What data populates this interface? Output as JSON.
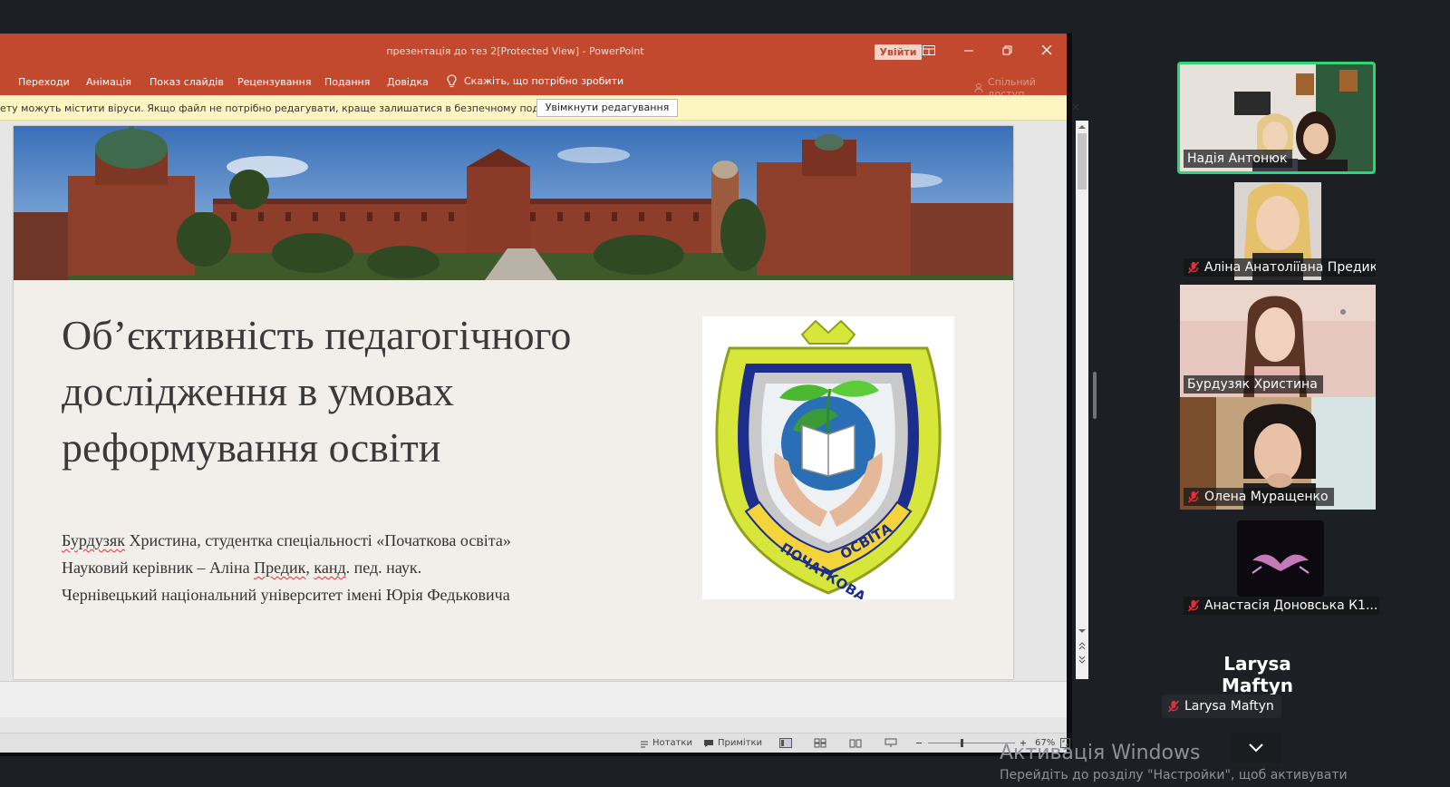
{
  "powerpoint": {
    "window_title": "презентація до тез 2[Protected View] - PowerPoint",
    "signin_label": "Увійти",
    "ribbon_tabs": [
      "Переходи",
      "Анімація",
      "Показ слайдів",
      "Рецензування",
      "Подання",
      "Довідка"
    ],
    "tell_me": "Скажіть, що потрібно зробити",
    "share": "Спільний доступ",
    "protected_message": "ету можуть містити віруси. Якщо файл не потрібно редагувати, краще залишатися в безпечному поданні.",
    "enable_editing": "Увімкнути редагування",
    "close_glyph": "×"
  },
  "slide": {
    "title_lines": [
      "Об’єктивність педагогічного",
      "дослідження в умовах",
      "реформування освіти"
    ],
    "author_name": "Бурдузяк",
    "author_rest": " Христина, студентка спеціальності «Початкова освіта»",
    "advisor_prefix": "Науковий керівник – Аліна ",
    "advisor_surname": "Предик",
    "advisor_sep": ", ",
    "advisor_degree": "канд",
    "advisor_rest": ". пед. наук.",
    "university": "Чернівецький національний університет імені Юрія Федьковича",
    "logo_text_left": "ПОЧАТКОВА",
    "logo_text_right": "ОСВІТА"
  },
  "statusbar": {
    "notes": "Нотатки",
    "comments": "Примітки",
    "zoom": "67%"
  },
  "participants": [
    {
      "name": "Надія Антонюк",
      "muted": false,
      "active": true
    },
    {
      "name": "Аліна Анатоліївна Предик",
      "muted": true,
      "active": false
    },
    {
      "name": "Бурдузяк Христина",
      "muted": false,
      "active": false
    },
    {
      "name": "Олена Муращенко",
      "muted": true,
      "active": false
    },
    {
      "name": "Анастасія Доновська К1...",
      "muted": true,
      "active": false
    }
  ],
  "no_video_participant": {
    "name": "Larysa Maftyn",
    "label": "Larysa Maftyn"
  },
  "windows_activation": {
    "line1": "Активація Windows",
    "line2": "Перейдіть до розділу \"Настройки\", щоб активувати"
  },
  "colors": {
    "ppt_accent": "#c2492d",
    "active_speaker": "#2ed573",
    "zoom_bg": "#1c1f24"
  }
}
